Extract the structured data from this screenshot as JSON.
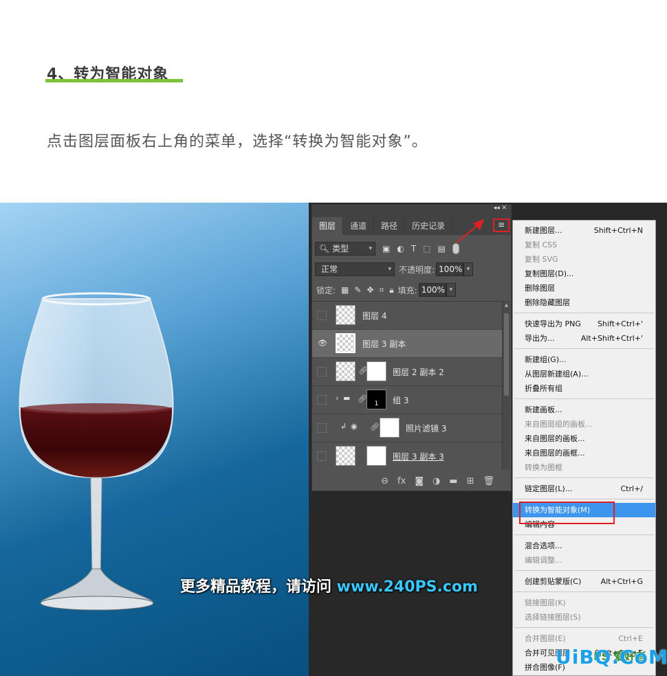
{
  "article": {
    "heading": "4、转为智能对象",
    "description": "点击图层面板右上角的菜单，选择“转换为智能对象”。"
  },
  "watermark": {
    "text": "更多精品教程，请访问 ",
    "url": "www.240PS.com"
  },
  "panel": {
    "collapse": "◂◂  ✕",
    "tabs": [
      "图层",
      "通道",
      "路径",
      "历史记录"
    ],
    "menu_icon": "≡",
    "filter_label": "类型",
    "blend_mode": "正常",
    "opacity_label": "不透明度:",
    "opacity": "100%",
    "lock_label": "锁定:",
    "fill_label": "填充:",
    "fill": "100%",
    "layers": [
      {
        "name": "图层 4"
      },
      {
        "name": "图层 3 副本"
      },
      {
        "name": "图层 2 副本 2"
      },
      {
        "name": "组 3",
        "mask_label": "1"
      },
      {
        "name": "照片滤镜 3"
      },
      {
        "name": "图层 3 副本 3"
      }
    ]
  },
  "menu": {
    "g1": [
      {
        "label": "新建图层...",
        "shortcut": "Shift+Ctrl+N"
      },
      {
        "label": "复制 CSS"
      },
      {
        "label": "复制 SVG"
      },
      {
        "label": "复制图层(D)..."
      },
      {
        "label": "删除图层"
      },
      {
        "label": "删除隐藏图层"
      }
    ],
    "g2": [
      {
        "label": "快速导出为 PNG",
        "shortcut": "Shift+Ctrl+'"
      },
      {
        "label": "导出为...",
        "shortcut": "Alt+Shift+Ctrl+'"
      }
    ],
    "g3": [
      {
        "label": "新建组(G)..."
      },
      {
        "label": "从图层新建组(A)..."
      },
      {
        "label": "折叠所有组"
      }
    ],
    "g4": [
      {
        "label": "新建画板..."
      },
      {
        "label": "来自图层组的画板..."
      },
      {
        "label": "来自图层的画板..."
      },
      {
        "label": "来自图层的画框..."
      },
      {
        "label": "转换为图框"
      }
    ],
    "g5": [
      {
        "label": "链定图层(L)...",
        "shortcut": "Ctrl+/"
      }
    ],
    "g6": [
      {
        "label": "转换为智能对象(M)"
      },
      {
        "label": "编辑内容"
      }
    ],
    "g7": [
      {
        "label": "混合选项..."
      },
      {
        "label": "编辑调整..."
      }
    ],
    "g8": [
      {
        "label": "创建剪贴蒙版(C)",
        "shortcut": "Alt+Ctrl+G"
      }
    ],
    "g9": [
      {
        "label": "链接图层(K)"
      },
      {
        "label": "选择链接图层(S)"
      }
    ],
    "g10": [
      {
        "label": "合并图层(E)",
        "shortcut": "Ctrl+E"
      },
      {
        "label": "合并可见图层",
        "shortcut": "Shift+Ctrl+E"
      },
      {
        "label": "拼合图像(F)"
      }
    ]
  },
  "logo": {
    "text": "UiBQ.CoM",
    "ps": "PS 爱好者"
  }
}
